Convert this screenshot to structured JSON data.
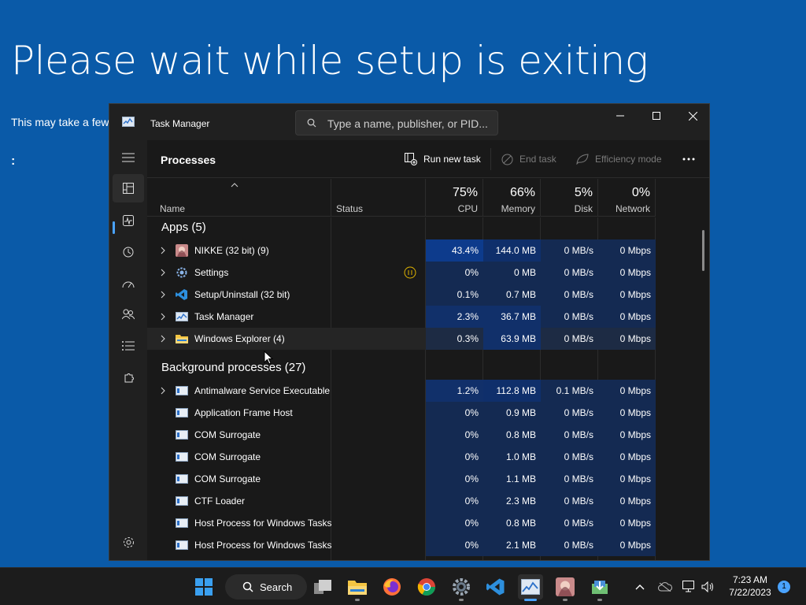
{
  "setup": {
    "title": "Please wait while setup is exiting",
    "subtitle": "This may take a few",
    "dots": ":"
  },
  "window": {
    "title": "Task Manager",
    "search_placeholder": "Type a name, publisher, or PID..."
  },
  "toolbar": {
    "title": "Processes",
    "run_new_task": "Run new task",
    "end_task": "End task",
    "efficiency_mode": "Efficiency mode"
  },
  "columns": {
    "name": "Name",
    "status": "Status",
    "cpu_pct": "75%",
    "cpu": "CPU",
    "memory_pct": "66%",
    "memory": "Memory",
    "disk_pct": "5%",
    "disk": "Disk",
    "network_pct": "0%",
    "network": "Network"
  },
  "groups": {
    "apps": "Apps (5)",
    "background": "Background processes (27)"
  },
  "apps": [
    {
      "name": "NIKKE (32 bit) (9)",
      "status": "",
      "cpu": "43.4%",
      "memory": "144.0 MB",
      "disk": "0 MB/s",
      "network": "0 Mbps",
      "icon": "nikke-icon",
      "expandable": true
    },
    {
      "name": "Settings",
      "status": "paused",
      "cpu": "0%",
      "memory": "0 MB",
      "disk": "0 MB/s",
      "network": "0 Mbps",
      "icon": "gear-icon",
      "expandable": true
    },
    {
      "name": "Setup/Uninstall (32 bit)",
      "status": "",
      "cpu": "0.1%",
      "memory": "0.7 MB",
      "disk": "0 MB/s",
      "network": "0 Mbps",
      "icon": "vscode-icon",
      "expandable": true
    },
    {
      "name": "Task Manager",
      "status": "",
      "cpu": "2.3%",
      "memory": "36.7 MB",
      "disk": "0 MB/s",
      "network": "0 Mbps",
      "icon": "task-manager-icon",
      "expandable": true
    },
    {
      "name": "Windows Explorer (4)",
      "status": "",
      "cpu": "0.3%",
      "memory": "63.9 MB",
      "disk": "0 MB/s",
      "network": "0 Mbps",
      "icon": "folder-icon",
      "expandable": true
    }
  ],
  "background": [
    {
      "name": "Antimalware Service Executable",
      "cpu": "1.2%",
      "memory": "112.8 MB",
      "disk": "0.1 MB/s",
      "network": "0 Mbps",
      "expandable": true
    },
    {
      "name": "Application Frame Host",
      "cpu": "0%",
      "memory": "0.9 MB",
      "disk": "0 MB/s",
      "network": "0 Mbps",
      "expandable": false
    },
    {
      "name": "COM Surrogate",
      "cpu": "0%",
      "memory": "0.8 MB",
      "disk": "0 MB/s",
      "network": "0 Mbps",
      "expandable": false
    },
    {
      "name": "COM Surrogate",
      "cpu": "0%",
      "memory": "1.0 MB",
      "disk": "0 MB/s",
      "network": "0 Mbps",
      "expandable": false
    },
    {
      "name": "COM Surrogate",
      "cpu": "0%",
      "memory": "1.1 MB",
      "disk": "0 MB/s",
      "network": "0 Mbps",
      "expandable": false
    },
    {
      "name": "CTF Loader",
      "cpu": "0%",
      "memory": "2.3 MB",
      "disk": "0 MB/s",
      "network": "0 Mbps",
      "expandable": false
    },
    {
      "name": "Host Process for Windows Tasks",
      "cpu": "0%",
      "memory": "0.8 MB",
      "disk": "0 MB/s",
      "network": "0 Mbps",
      "expandable": false
    },
    {
      "name": "Host Process for Windows Tasks",
      "cpu": "0%",
      "memory": "2.1 MB",
      "disk": "0 MB/s",
      "network": "0 Mbps",
      "expandable": false
    }
  ],
  "taskbar": {
    "search_label": "Search",
    "time": "7:23 AM",
    "date": "7/22/2023",
    "notifications": "1"
  },
  "colors": {
    "accent": "#4aa3ff",
    "desktop": "#0a5aa8",
    "heat_high": "#0d3b8c",
    "heat_med": "#0f2f6b",
    "heat_low": "#142a52"
  }
}
